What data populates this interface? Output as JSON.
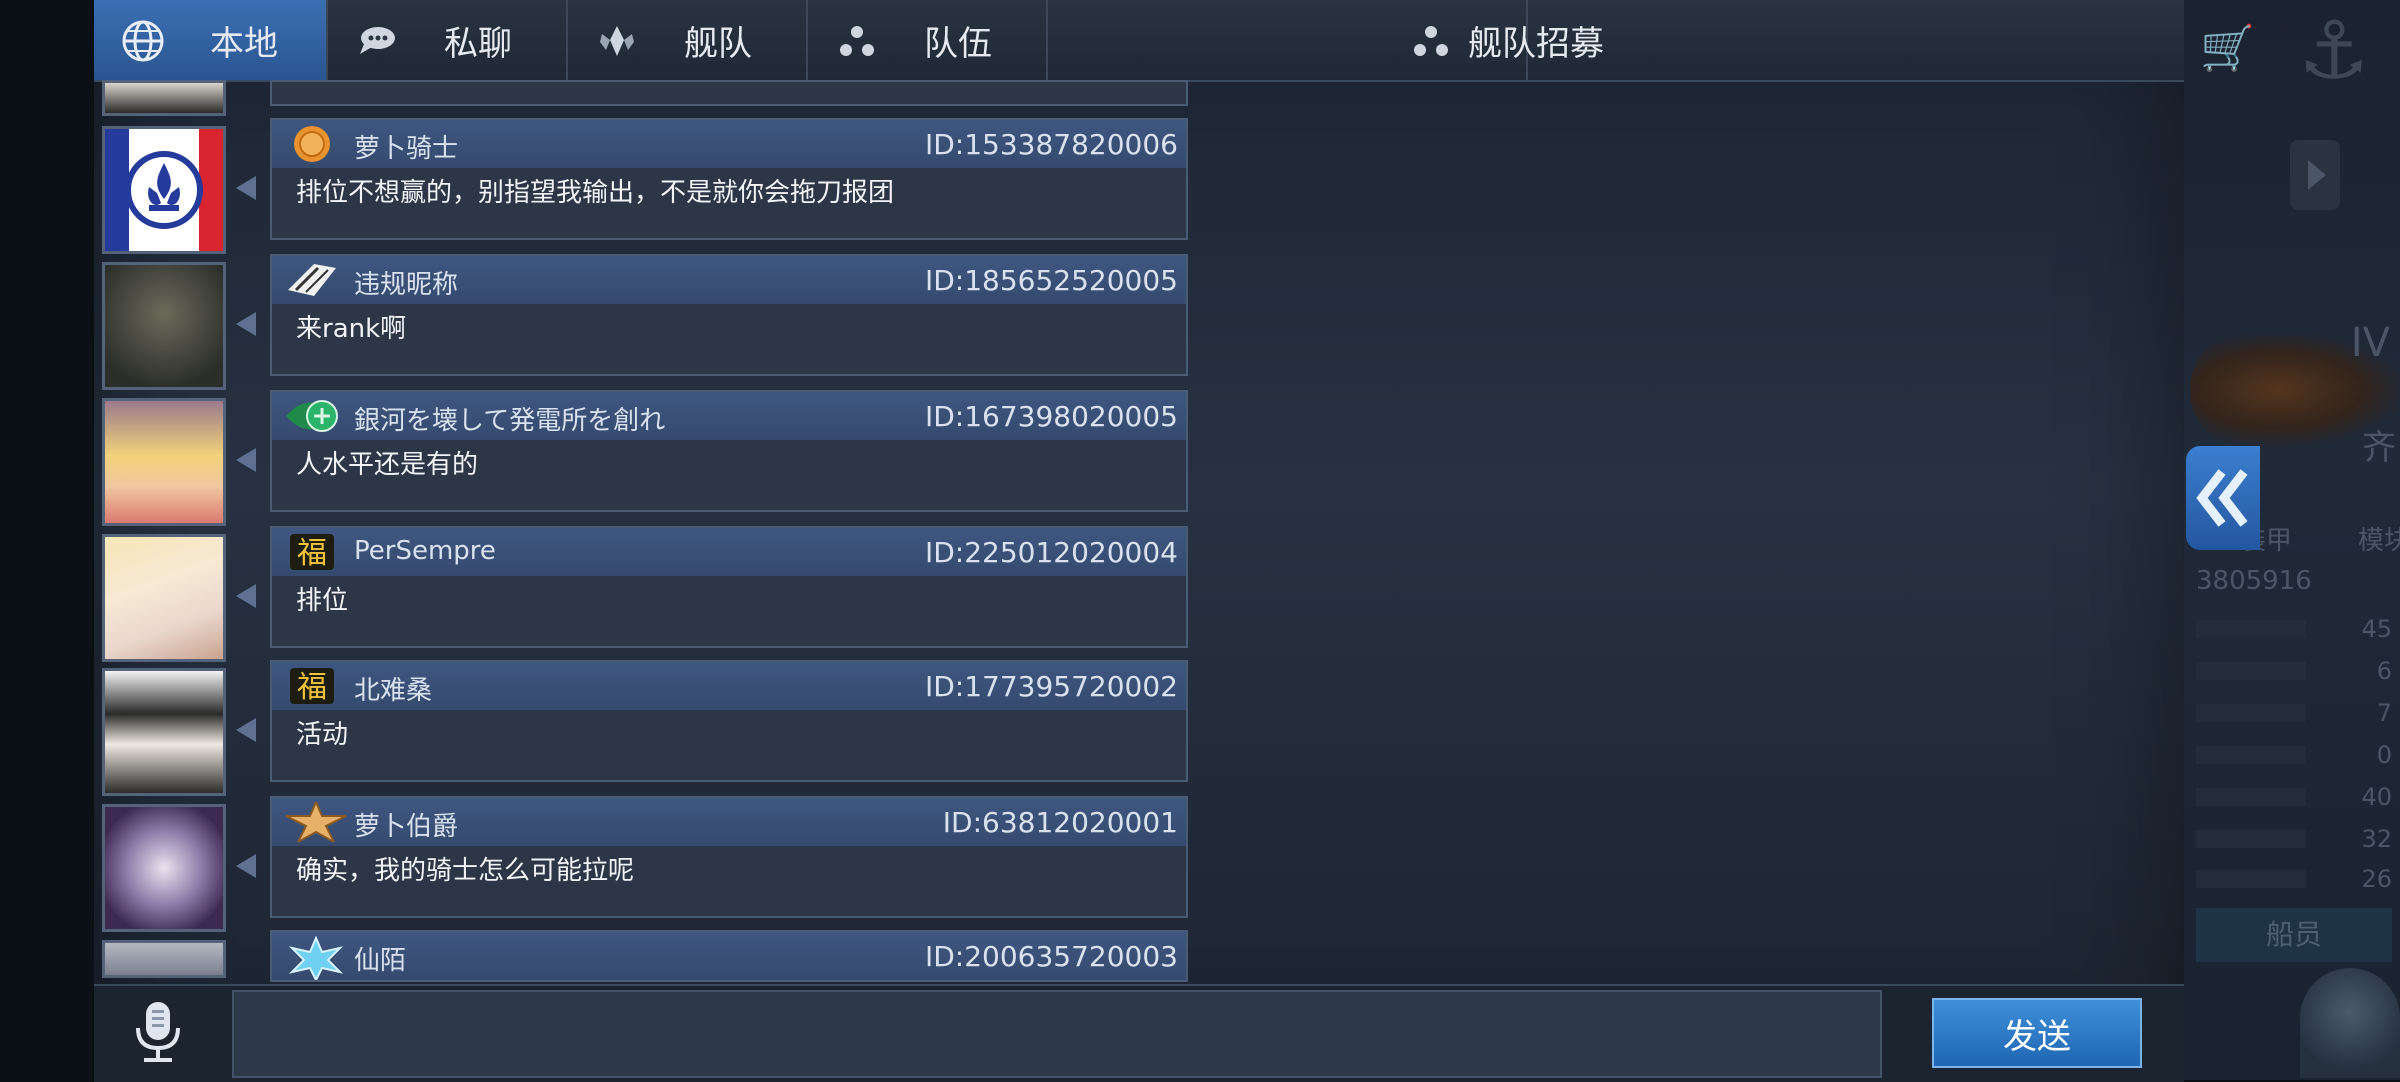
{
  "tabs": [
    {
      "label": "本地",
      "icon": "globe-icon",
      "active": true
    },
    {
      "label": "私聊",
      "icon": "chat-bubble-icon",
      "active": false
    },
    {
      "label": "舰队",
      "icon": "fleet-emblem-icon",
      "active": false
    },
    {
      "label": "队伍",
      "icon": "team-dots-icon",
      "active": false
    },
    {
      "label": "舰队招募",
      "icon": "team-dots-icon",
      "active": false
    }
  ],
  "messages": [
    {
      "name": "萝卜骑士",
      "id": "ID:153387820006",
      "text": "排位不想赢的，别指望我输出，不是就你会拖刀报团",
      "badge": "orange-medal-badge"
    },
    {
      "name": "违规昵称",
      "id": "ID:185652520005",
      "text": "来rank啊",
      "badge": "ribbon-badge"
    },
    {
      "name": "銀河を壊して発電所を創れ",
      "id": "ID:167398020005",
      "text": "人水平还是有的",
      "badge": "green-wing-badge"
    },
    {
      "name": "PerSempre",
      "id": "ID:225012020004",
      "text": "排位",
      "badge": "fu-badge"
    },
    {
      "name": "北难桑",
      "id": "ID:177395720002",
      "text": "活动",
      "badge": "fu-badge"
    },
    {
      "name": "萝卜伯爵",
      "id": "ID:63812020001",
      "text": "确实，我的骑士怎么可能拉呢",
      "badge": "gold-star-badge"
    },
    {
      "name": "仙陌",
      "id": "ID:200635720003",
      "text": "",
      "badge": "ice-crystal-badge"
    }
  ],
  "input": {
    "placeholder": "",
    "value": ""
  },
  "send_label": "发送",
  "background": {
    "tier": "IV",
    "qi": "齐",
    "ship_id": "3805916",
    "tabs": [
      "装甲",
      "模块"
    ],
    "stats": [
      "45",
      "6",
      "7",
      "0",
      "40",
      "32",
      "26"
    ],
    "crew_label": "船员"
  },
  "colors": {
    "accent": "#2f63a8",
    "header": "#3f5680",
    "send": "#2a78c6"
  }
}
